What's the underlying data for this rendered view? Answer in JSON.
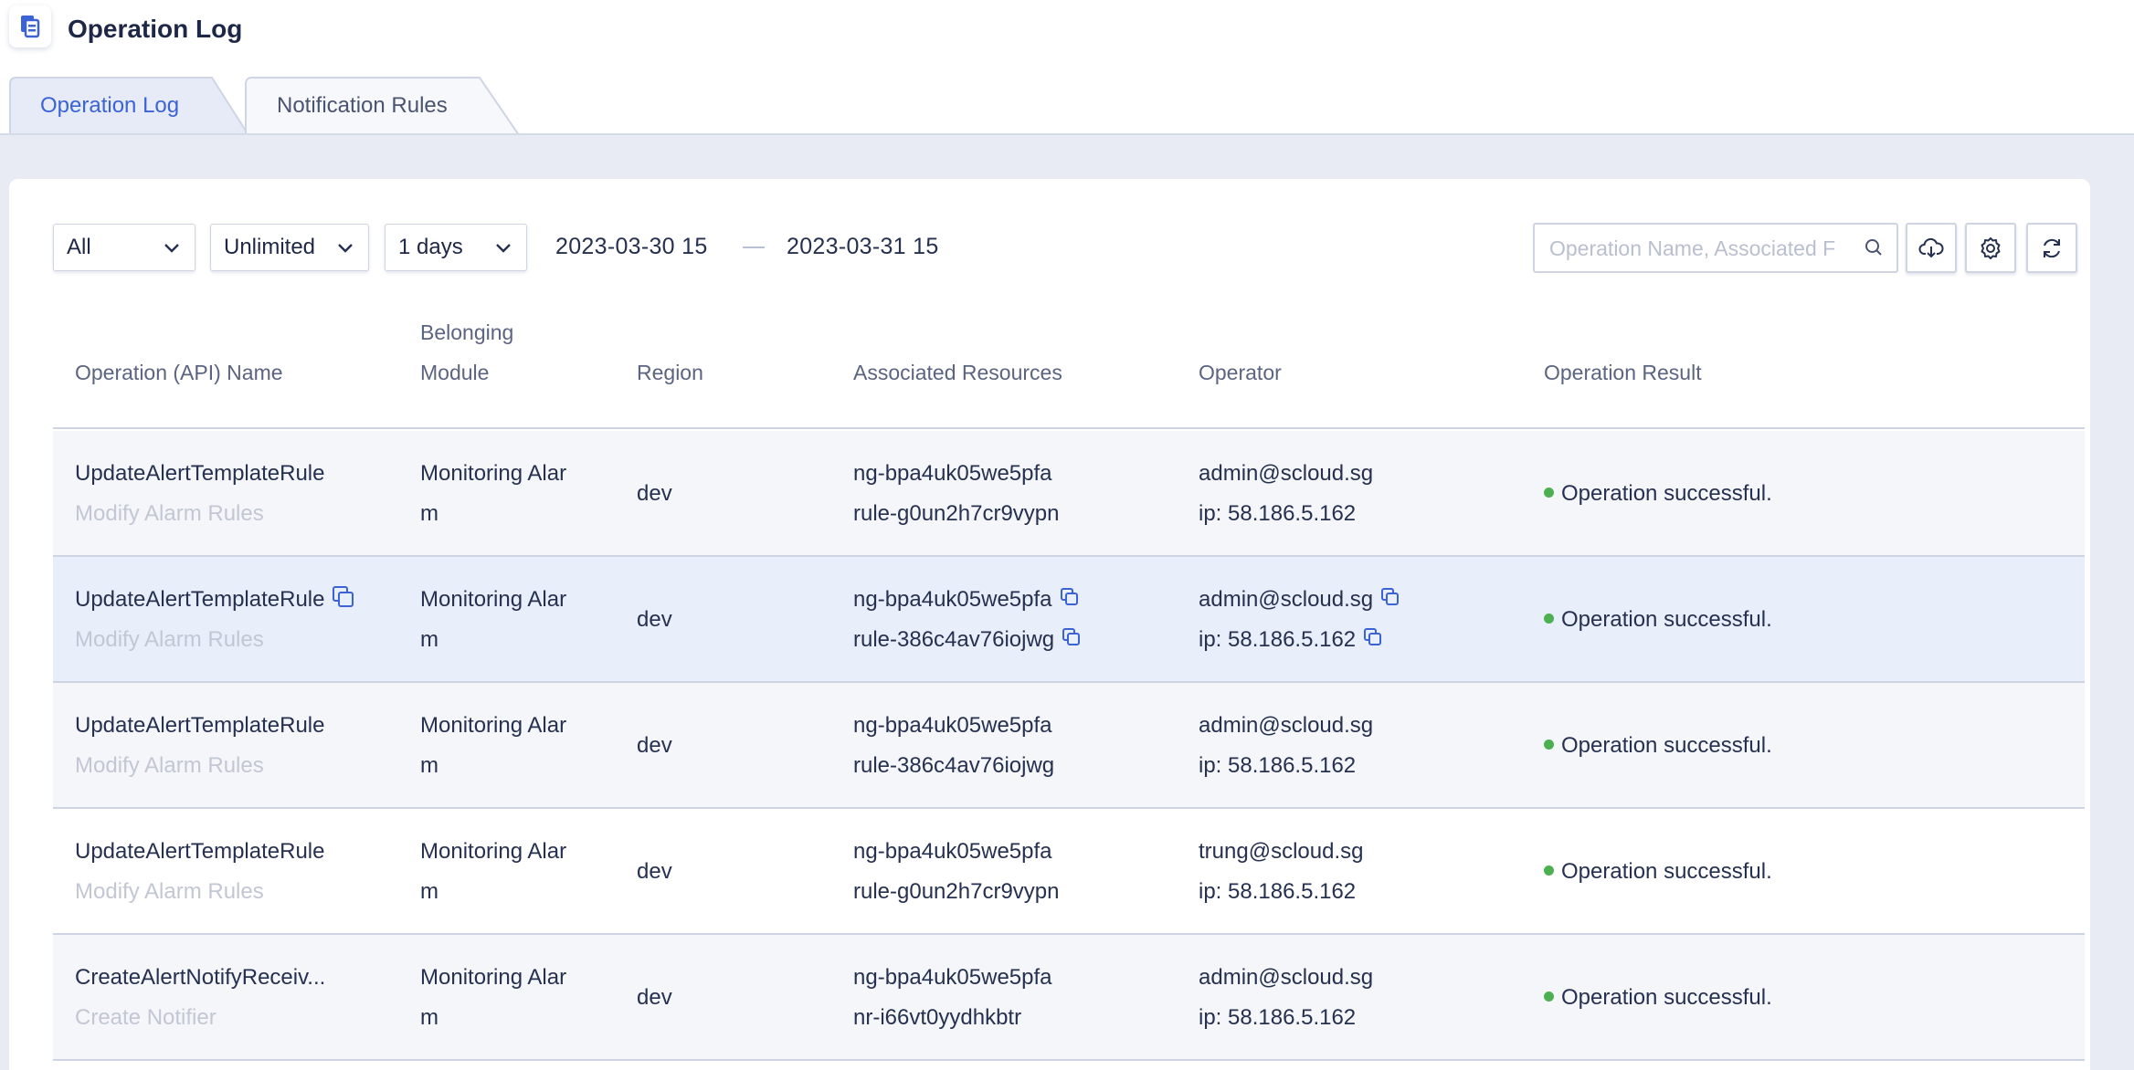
{
  "page": {
    "title": "Operation Log"
  },
  "tabs": [
    {
      "label": "Operation Log",
      "active": true
    },
    {
      "label": "Notification Rules",
      "active": false
    }
  ],
  "filters": {
    "scope": "All",
    "limit": "Unlimited",
    "range": "1 days",
    "start": "2023-03-30 15",
    "end": "2023-03-31 15",
    "search_placeholder": "Operation Name, Associated F"
  },
  "icons": {
    "export": "cloud-download-icon",
    "settings": "gear-icon",
    "refresh": "refresh-icon",
    "copy": "copy-icon",
    "search": "search-icon"
  },
  "colors": {
    "accent": "#3b63d6",
    "success": "#4caf50"
  },
  "table": {
    "headers": {
      "name": "Operation (API) Name",
      "module_1": "Belonging",
      "module_2": "Module",
      "region": "Region",
      "resources": "Associated Resources",
      "operator": "Operator",
      "result": "Operation Result"
    },
    "rows": [
      {
        "name": "UpdateAlertTemplateRule",
        "desc": "Modify Alarm Rules",
        "module_1": "Monitoring Alar",
        "module_2": "m",
        "region": "dev",
        "res_1": "ng-bpa4uk05we5pfa",
        "res_2": "rule-g0un2h7cr9vypn",
        "operator": "admin@scloud.sg",
        "ip": "ip: 58.186.5.162",
        "result": "Operation successful."
      },
      {
        "name": "UpdateAlertTemplateRule",
        "desc": "Modify Alarm Rules",
        "module_1": "Monitoring Alar",
        "module_2": "m",
        "region": "dev",
        "res_1": "ng-bpa4uk05we5pfa",
        "res_2": "rule-386c4av76iojwg",
        "operator": "admin@scloud.sg",
        "ip": "ip: 58.186.5.162",
        "result": "Operation successful."
      },
      {
        "name": "UpdateAlertTemplateRule",
        "desc": "Modify Alarm Rules",
        "module_1": "Monitoring Alar",
        "module_2": "m",
        "region": "dev",
        "res_1": "ng-bpa4uk05we5pfa",
        "res_2": "rule-386c4av76iojwg",
        "operator": "admin@scloud.sg",
        "ip": "ip: 58.186.5.162",
        "result": "Operation successful."
      },
      {
        "name": "UpdateAlertTemplateRule",
        "desc": "Modify Alarm Rules",
        "module_1": "Monitoring Alar",
        "module_2": "m",
        "region": "dev",
        "res_1": "ng-bpa4uk05we5pfa",
        "res_2": "rule-g0un2h7cr9vypn",
        "operator": "trung@scloud.sg",
        "ip": "ip: 58.186.5.162",
        "result": "Operation successful."
      },
      {
        "name": "CreateAlertNotifyReceiv...",
        "desc": "Create Notifier",
        "module_1": "Monitoring Alar",
        "module_2": "m",
        "region": "dev",
        "res_1": "ng-bpa4uk05we5pfa",
        "res_2": "nr-i66vt0yydhkbtr",
        "operator": "admin@scloud.sg",
        "ip": "ip: 58.186.5.162",
        "result": "Operation successful."
      }
    ]
  }
}
